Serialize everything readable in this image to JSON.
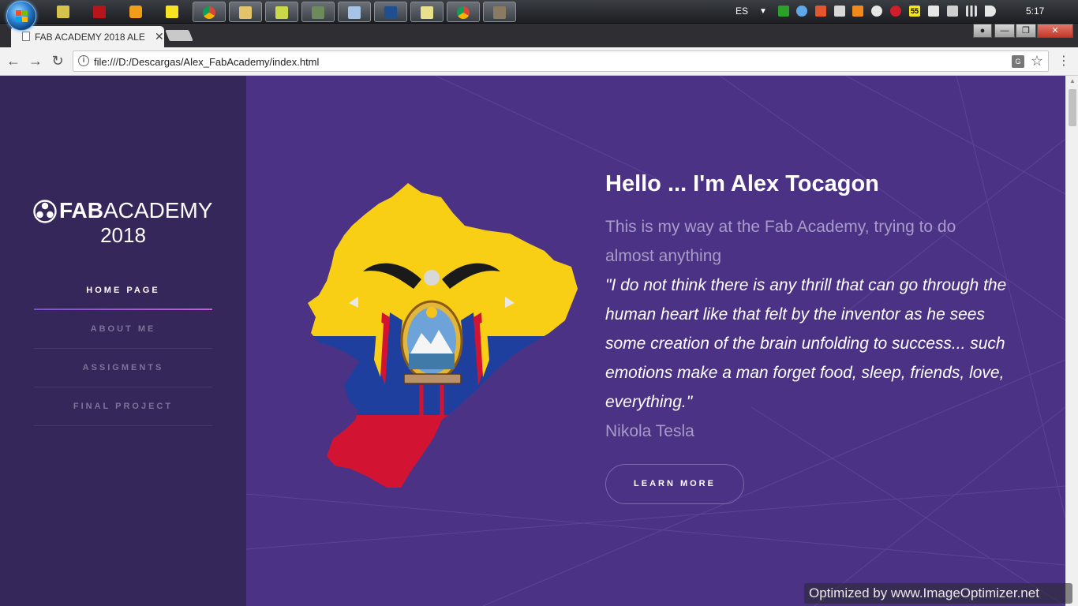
{
  "taskbar": {
    "language": "ES",
    "clock": "5:17",
    "tray_badge": "55"
  },
  "browser": {
    "tab_title": "FAB ACADEMY 2018 ALE",
    "tab_close": "✕",
    "url": "file:///D:/Descargas/Alex_FabAcademy/index.html",
    "window_controls": {
      "minimize": "—",
      "maximize": "❐",
      "close": "✕"
    }
  },
  "sidebar": {
    "logo_fab": "FAB",
    "logo_academy": "ACADEMY",
    "logo_year": "2018",
    "nav": [
      {
        "label": "HOME PAGE",
        "active": true
      },
      {
        "label": "ABOUT ME",
        "active": false
      },
      {
        "label": "ASSIGMENTS",
        "active": false
      },
      {
        "label": "FINAL PROJECT",
        "active": false
      }
    ]
  },
  "hero": {
    "title": "Hello ... I'm Alex Tocagon",
    "subtitle": "This is my way at the Fab Academy, trying to do almost anything",
    "quote": "\"I do not think there is any thrill that can go through the human heart like that felt by the inventor as he sees some creation of the brain unfolding to success... such emotions make a man forget food, sleep, friends, love, everything.\"",
    "author": "Nikola Tesla",
    "button_label": "LEARN MORE"
  },
  "colors": {
    "sidebar_bg": "#35275a",
    "main_bg": "#4b3285",
    "flag_yellow": "#f9cf16",
    "flag_blue": "#1f3f9e",
    "flag_red": "#d21432"
  },
  "watermark": "Optimized by www.ImageOptimizer.net"
}
